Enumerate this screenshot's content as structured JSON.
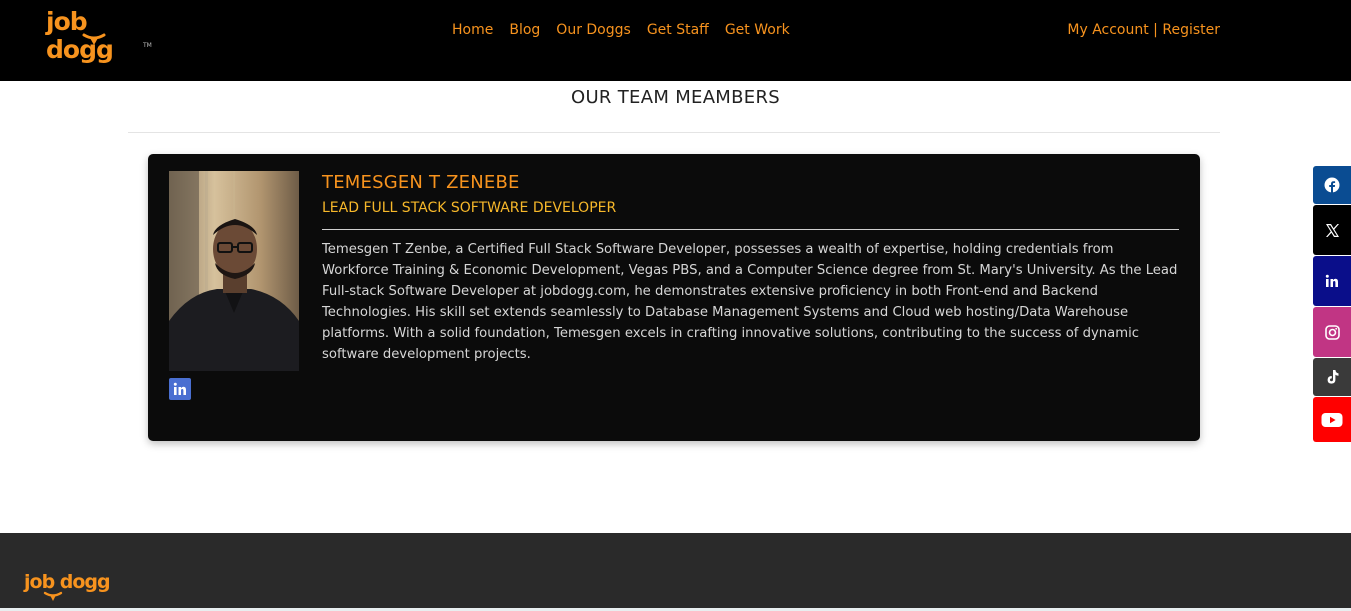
{
  "header": {
    "logo_text": "job dogg",
    "logo_tm": "TM",
    "nav": [
      {
        "label": "Home"
      },
      {
        "label": "Blog"
      },
      {
        "label": "Our Doggs"
      },
      {
        "label": "Get Staff"
      },
      {
        "label": "Get Work"
      }
    ],
    "account_label": "My Account",
    "separator": " | ",
    "register_label": "Register"
  },
  "section": {
    "title": "OUR TEAM MEAMBERS"
  },
  "member": {
    "name": "TEMESGEN T ZENEBE",
    "role": "LEAD FULL STACK SOFTWARE DEVELOPER",
    "bio": "Temesgen T Zenbe, a Certified Full Stack Software Developer, possesses a wealth of expertise, holding credentials from Workforce Training & Economic Development, Vegas PBS, and a Computer Science degree from St. Mary's University. As the Lead Full-stack Software Developer at jobdogg.com, he demonstrates extensive proficiency in both Front-end and Backend Technologies. His skill set extends seamlessly to Database Management Systems and Cloud web hosting/Data Warehouse platforms. With a solid foundation, Temesgen excels in crafting innovative solutions, contributing to the success of dynamic software development projects.",
    "linkedin_icon": "linkedin-icon"
  },
  "social": [
    {
      "icon": "facebook-icon",
      "color": "#0a4c92"
    },
    {
      "icon": "x-icon",
      "color": "#000000"
    },
    {
      "icon": "linkedin-icon",
      "color": "#0a0e8a"
    },
    {
      "icon": "instagram-icon",
      "color": "#c13584"
    },
    {
      "icon": "tiktok-icon",
      "color": "#3a3a3a"
    },
    {
      "icon": "youtube-icon",
      "color": "#ff0000"
    }
  ],
  "footer": {
    "logo_text": "job dogg"
  },
  "colors": {
    "brand_orange": "#f7931e",
    "role_yellow": "#f7b82a",
    "header_bg": "#000000",
    "card_bg": "#0b0b0b",
    "footer_bg": "#2a2a2a"
  }
}
